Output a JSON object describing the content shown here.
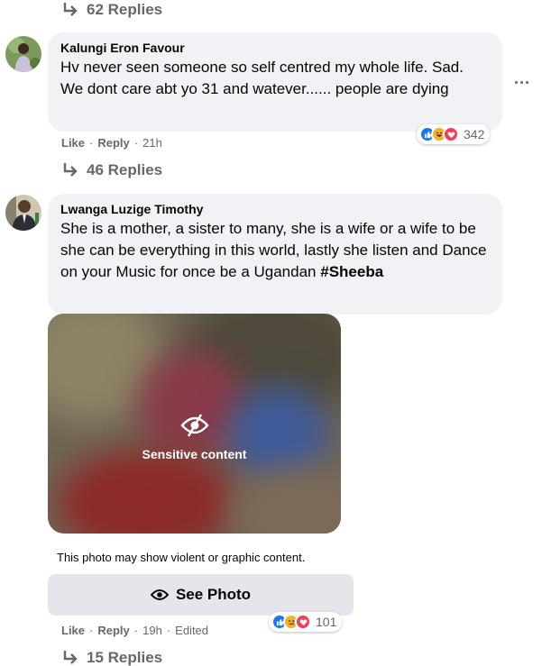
{
  "top_replies": {
    "label": "62 Replies"
  },
  "comment1": {
    "author": "Kalungi Eron Favour",
    "text": "Hv never seen someone so self centred my whole life. Sad. We dont care abt yo 31 and watever...... people are dying",
    "actions": {
      "like": "Like",
      "reply": "Reply",
      "time": "21h"
    },
    "reactions": {
      "icons": [
        "like-icon",
        "haha-icon",
        "love-icon"
      ],
      "count": "342"
    },
    "replies_label": "46 Replies"
  },
  "comment2": {
    "author": "Lwanga Luzige Timothy",
    "text": "She is a mother, a sister to many, she is a wife or a wife to be she can be everything in this world, lastly she listen and Dance on your Music for once be a Ugandan",
    "hashtag": "#Sheeba",
    "sensitive": {
      "title": "Sensitive content",
      "warning": "This photo may show violent or graphic content.",
      "button_label": "See Photo"
    },
    "actions": {
      "like": "Like",
      "reply": "Reply",
      "time": "19h",
      "edited": "Edited"
    },
    "reactions": {
      "icons": [
        "like-icon",
        "sad-icon",
        "love-icon"
      ],
      "count": "101"
    },
    "replies_label": "15 Replies"
  },
  "colors": {
    "like_blue": "#1877f2",
    "love_red": "#f33e58",
    "haha_yellow": "#f7b125",
    "bubble_bg": "#f0f2f5",
    "muted_text": "#65676b"
  }
}
